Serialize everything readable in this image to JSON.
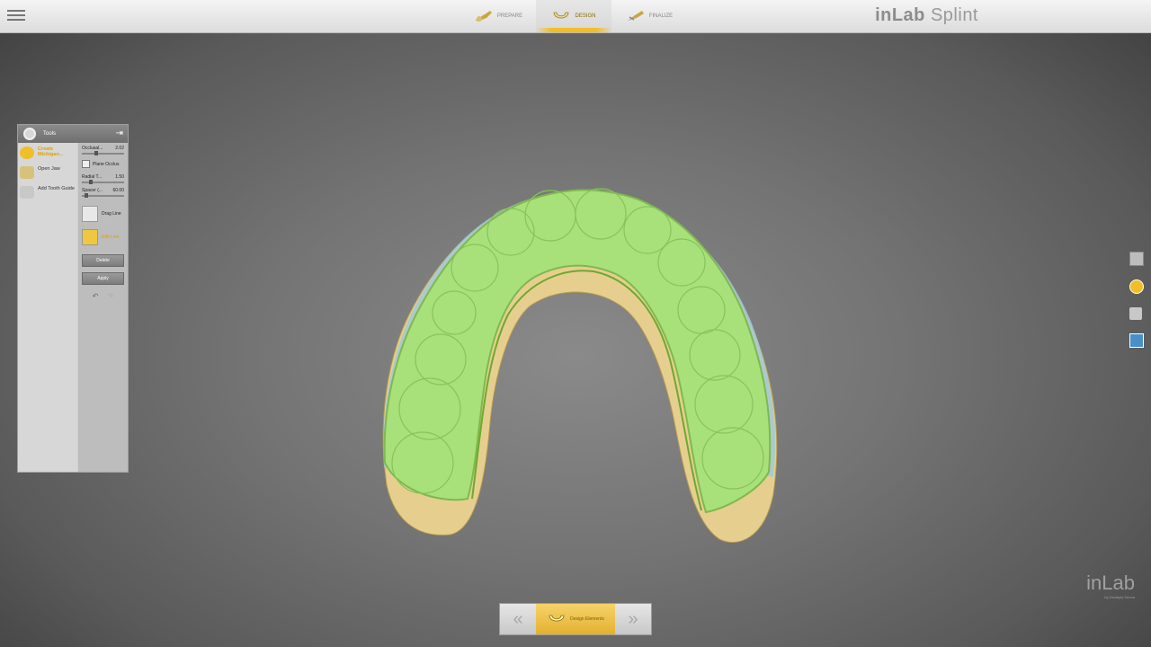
{
  "app": {
    "title_bold": "inLab",
    "title_light": " Splint"
  },
  "steps": [
    {
      "label": "PREPARE",
      "active": false
    },
    {
      "label": "DESIGN",
      "active": true
    },
    {
      "label": "FINALIZE",
      "active": false
    }
  ],
  "tools_panel": {
    "title": "Tools",
    "tools": [
      {
        "label": "Create Michigan...",
        "icon": "splint-icon",
        "active": true
      },
      {
        "label": "Open Jaw",
        "icon": "jaw-icon",
        "active": false
      },
      {
        "label": "Add Tooth Guide",
        "icon": "tooth-guide-icon",
        "active": false
      }
    ],
    "params": {
      "occlusal_label": "Occlusal...",
      "occlusal_value": "2.02",
      "plane_occlusal_label": "Plane Occlus",
      "radial_label": "Radial T...",
      "radial_value": "1.50",
      "spacer_label": "Spacer (...",
      "spacer_value": "60.00"
    },
    "sub_tools": [
      {
        "label": "Drag Line",
        "active": false
      },
      {
        "label": "Edit Line",
        "active": true
      }
    ],
    "delete_label": "Delete",
    "apply_label": "Apply"
  },
  "bottom_nav": {
    "label": "Design Elements"
  },
  "watermark": {
    "text": "inLab",
    "sub": "by Dentsply Sirona"
  },
  "colors": {
    "accent": "#f0be28",
    "splint_green": "#a8e07a",
    "model_yellow": "#e8d49a",
    "model_blue": "#9ec8dc"
  }
}
